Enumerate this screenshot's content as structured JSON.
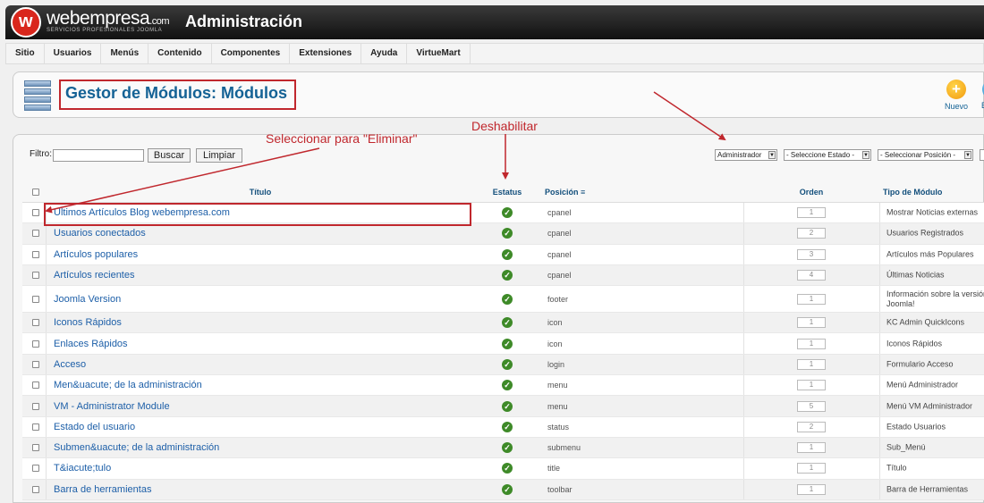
{
  "brand": {
    "logo_letter": "w",
    "name": "webempresa",
    "domain": ".com",
    "tagline": "SERVICIOS PROFESIONALES JOOMLA"
  },
  "header": {
    "title": "Administración"
  },
  "menu": [
    "Sitio",
    "Usuarios",
    "Menús",
    "Contenido",
    "Componentes",
    "Extensiones",
    "Ayuda",
    "VirtueMart"
  ],
  "page": {
    "title": "Gestor de Módulos: Módulos",
    "new_label": "Nuevo",
    "next_label": "E"
  },
  "filter": {
    "label": "Filtro:",
    "value": "",
    "search_button": "Buscar",
    "clear_button": "Limpiar"
  },
  "selects": {
    "client": "Administrador",
    "state": "- Seleccione Estado -",
    "position": "- Seleccionar Posición -"
  },
  "table": {
    "headers": {
      "title": "Título",
      "status": "Estatus",
      "position": "Posición",
      "order": "Orden",
      "type": "Tipo de Módulo"
    },
    "rows": [
      {
        "title": "Ultimos Artículos Blog webempresa.com",
        "position": "cpanel",
        "order": "1",
        "type": "Mostrar Noticias externas"
      },
      {
        "title": "Usuarios conectados",
        "position": "cpanel",
        "order": "2",
        "type": "Usuarios Registrados"
      },
      {
        "title": "Artículos populares",
        "position": "cpanel",
        "order": "3",
        "type": "Artículos más Populares"
      },
      {
        "title": "Artículos recientes",
        "position": "cpanel",
        "order": "4",
        "type": "Últimas Noticias"
      },
      {
        "title": "Joomla Version",
        "position": "footer",
        "order": "1",
        "type": "Información sobre la versión",
        "type2": "Joomla!"
      },
      {
        "title": "Iconos Rápidos",
        "position": "icon",
        "order": "1",
        "type": "KC Admin QuickIcons"
      },
      {
        "title": "Enlaces Rápidos",
        "position": "icon",
        "order": "1",
        "type": "Iconos Rápidos"
      },
      {
        "title": "Acceso",
        "position": "login",
        "order": "1",
        "type": "Formulario Acceso"
      },
      {
        "title": "Men&uacute; de la administración",
        "position": "menu",
        "order": "1",
        "type": "Menú Administrador"
      },
      {
        "title": "VM - Administrator Module",
        "position": "menu",
        "order": "5",
        "type": "Menú VM Administrador"
      },
      {
        "title": "Estado del usuario",
        "position": "status",
        "order": "2",
        "type": "Estado Usuarios"
      },
      {
        "title": "Submen&uacute; de la administración",
        "position": "submenu",
        "order": "1",
        "type": "Sub_Menú"
      },
      {
        "title": "T&iacute;tulo",
        "position": "title",
        "order": "1",
        "type": "Título"
      },
      {
        "title": "Barra de herramientas",
        "position": "toolbar",
        "order": "1",
        "type": "Barra de Herramientas"
      }
    ]
  },
  "annotations": {
    "delete": "Seleccionar para \"Eliminar\"",
    "disable": "Deshabilitar"
  },
  "colors": {
    "link": "#1d5fa8",
    "title": "#146295",
    "annotation": "#c0272d",
    "status_ok": "#3e8a28"
  }
}
